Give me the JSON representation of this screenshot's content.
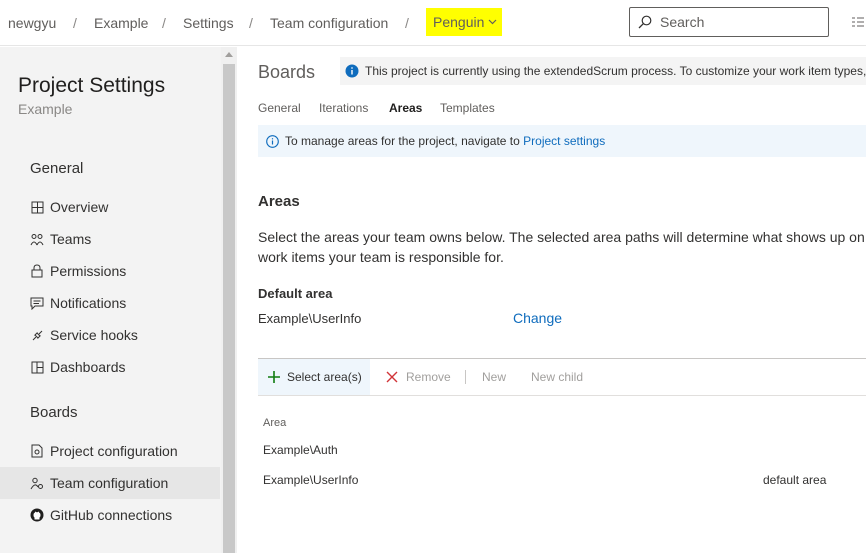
{
  "breadcrumb": {
    "org": "newgyu",
    "project": "Example",
    "settings": "Settings",
    "section": "Team configuration",
    "team": "Penguin",
    "separator": "/"
  },
  "search": {
    "placeholder": "Search"
  },
  "sidebar": {
    "title": "Project Settings",
    "subtitle": "Example",
    "groups": [
      {
        "heading": "General",
        "items": [
          {
            "label": "Overview",
            "icon": "overview-icon"
          },
          {
            "label": "Teams",
            "icon": "teams-icon"
          },
          {
            "label": "Permissions",
            "icon": "lock-icon"
          },
          {
            "label": "Notifications",
            "icon": "notifications-icon"
          },
          {
            "label": "Service hooks",
            "icon": "service-hooks-icon"
          },
          {
            "label": "Dashboards",
            "icon": "dashboards-icon"
          }
        ]
      },
      {
        "heading": "Boards",
        "items": [
          {
            "label": "Project configuration",
            "icon": "project-configuration-icon"
          },
          {
            "label": "Team configuration",
            "icon": "team-configuration-icon",
            "selected": true
          },
          {
            "label": "GitHub connections",
            "icon": "github-icon"
          }
        ]
      }
    ]
  },
  "main": {
    "title": "Boards",
    "banner": "This project is currently using the extendedScrum process. To customize your work item types, g",
    "tabs": [
      {
        "label": "General",
        "active": false
      },
      {
        "label": "Iterations",
        "active": false
      },
      {
        "label": "Areas",
        "active": true
      },
      {
        "label": "Templates",
        "active": false
      }
    ],
    "info": {
      "text": "To manage areas for the project, navigate to",
      "link": "Project settings"
    },
    "areas": {
      "title": "Areas",
      "description_line1": "Select the areas your team owns below. The selected area paths will determine what shows up on y",
      "description_line2": "work items your team is responsible for.",
      "default_label": "Default area",
      "default_value": "Example\\UserInfo",
      "change_link": "Change"
    },
    "toolbar": {
      "select_label": "Select area(s)",
      "remove_label": "Remove",
      "new_label": "New",
      "new_child_label": "New child"
    },
    "table": {
      "column": "Area",
      "rows": [
        {
          "area": "Example\\Auth",
          "note": ""
        },
        {
          "area": "Example\\UserInfo",
          "note": "default area"
        }
      ]
    }
  },
  "colors": {
    "accent": "#0f6cbd",
    "highlight": "#ffff00",
    "sidebar_bg": "#f3f3f3",
    "selected_bg": "#e6e6e6",
    "add_green": "#107c10",
    "remove_red": "#d13438"
  }
}
